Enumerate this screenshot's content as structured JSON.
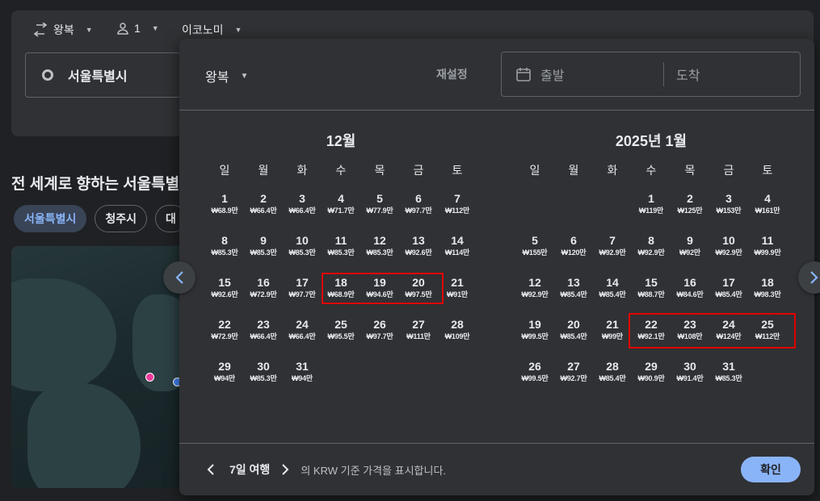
{
  "search_options": {
    "trip_type": "왕복",
    "passengers": "1",
    "cabin_class": "이코노미"
  },
  "origin": "서울특별시",
  "explore": {
    "title": "전 세계로 향하는 서울특별",
    "chips": [
      "서울특별시",
      "청주시",
      "대"
    ]
  },
  "picker": {
    "trip_type": "왕복",
    "reset_label": "재설정",
    "departure_placeholder": "출발",
    "return_placeholder": "도착",
    "months": [
      {
        "title": "12월",
        "weekdays": [
          "일",
          "월",
          "화",
          "수",
          "목",
          "금",
          "토"
        ],
        "days": [
          {
            "d": "1",
            "p": "₩68.9만"
          },
          {
            "d": "2",
            "p": "₩66.4만"
          },
          {
            "d": "3",
            "p": "₩66.4만"
          },
          {
            "d": "4",
            "p": "₩71.7만"
          },
          {
            "d": "5",
            "p": "₩77.9만"
          },
          {
            "d": "6",
            "p": "₩97.7만"
          },
          {
            "d": "7",
            "p": "₩112만"
          },
          {
            "d": "8",
            "p": "₩85.3만"
          },
          {
            "d": "9",
            "p": "₩85.3만"
          },
          {
            "d": "10",
            "p": "₩85.3만"
          },
          {
            "d": "11",
            "p": "₩85.3만"
          },
          {
            "d": "12",
            "p": "₩85.3만"
          },
          {
            "d": "13",
            "p": "₩92.6만"
          },
          {
            "d": "14",
            "p": "₩114만"
          },
          {
            "d": "15",
            "p": "₩92.6만"
          },
          {
            "d": "16",
            "p": "₩72.9만"
          },
          {
            "d": "17",
            "p": "₩97.7만"
          },
          {
            "d": "18",
            "p": "₩68.9만"
          },
          {
            "d": "19",
            "p": "₩94.6만"
          },
          {
            "d": "20",
            "p": "₩97.5만"
          },
          {
            "d": "21",
            "p": "₩91만"
          },
          {
            "d": "22",
            "p": "₩72.9만"
          },
          {
            "d": "23",
            "p": "₩66.4만"
          },
          {
            "d": "24",
            "p": "₩66.4만"
          },
          {
            "d": "25",
            "p": "₩95.5만"
          },
          {
            "d": "26",
            "p": "₩97.7만"
          },
          {
            "d": "27",
            "p": "₩111만"
          },
          {
            "d": "28",
            "p": "₩109만"
          },
          {
            "d": "29",
            "p": "₩94만"
          },
          {
            "d": "30",
            "p": "₩85.3만"
          },
          {
            "d": "31",
            "p": "₩94만"
          }
        ]
      },
      {
        "title": "2025년 1월",
        "weekdays": [
          "일",
          "월",
          "화",
          "수",
          "목",
          "금",
          "토"
        ],
        "days": [
          null,
          null,
          null,
          {
            "d": "1",
            "p": "₩119만"
          },
          {
            "d": "2",
            "p": "₩125만"
          },
          {
            "d": "3",
            "p": "₩153만"
          },
          {
            "d": "4",
            "p": "₩161만"
          },
          {
            "d": "5",
            "p": "₩155만"
          },
          {
            "d": "6",
            "p": "₩120만"
          },
          {
            "d": "7",
            "p": "₩92.9만"
          },
          {
            "d": "8",
            "p": "₩92.9만"
          },
          {
            "d": "9",
            "p": "₩92만"
          },
          {
            "d": "10",
            "p": "₩92.9만"
          },
          {
            "d": "11",
            "p": "₩99.9만"
          },
          {
            "d": "12",
            "p": "₩92.9만"
          },
          {
            "d": "13",
            "p": "₩85.4만"
          },
          {
            "d": "14",
            "p": "₩85.4만"
          },
          {
            "d": "15",
            "p": "₩88.7만"
          },
          {
            "d": "16",
            "p": "₩84.6만"
          },
          {
            "d": "17",
            "p": "₩85.4만"
          },
          {
            "d": "18",
            "p": "₩98.3만"
          },
          {
            "d": "19",
            "p": "₩99.5만"
          },
          {
            "d": "20",
            "p": "₩85.4만"
          },
          {
            "d": "21",
            "p": "₩99만"
          },
          {
            "d": "22",
            "p": "₩92.1만"
          },
          {
            "d": "23",
            "p": "₩108만"
          },
          {
            "d": "24",
            "p": "₩124만"
          },
          {
            "d": "25",
            "p": "₩112만"
          },
          {
            "d": "26",
            "p": "₩99.5만"
          },
          {
            "d": "27",
            "p": "₩92.7만"
          },
          {
            "d": "28",
            "p": "₩85.4만"
          },
          {
            "d": "29",
            "p": "₩90.9만"
          },
          {
            "d": "30",
            "p": "₩91.4만"
          },
          {
            "d": "31",
            "p": "₩85.3만"
          }
        ]
      }
    ],
    "footer": {
      "trip_length": "7일 여행",
      "note": "의 KRW 기준 가격을 표시합니다."
    },
    "confirm_label": "확인"
  },
  "colors": {
    "background": "#202124",
    "surface": "#303134",
    "accent": "#8ab4f8",
    "highlight": "#e30000"
  },
  "icons": [
    "swap-icon",
    "person-icon",
    "origin-circle-icon",
    "calendar-icon",
    "chevron-left-icon",
    "chevron-right-icon"
  ]
}
